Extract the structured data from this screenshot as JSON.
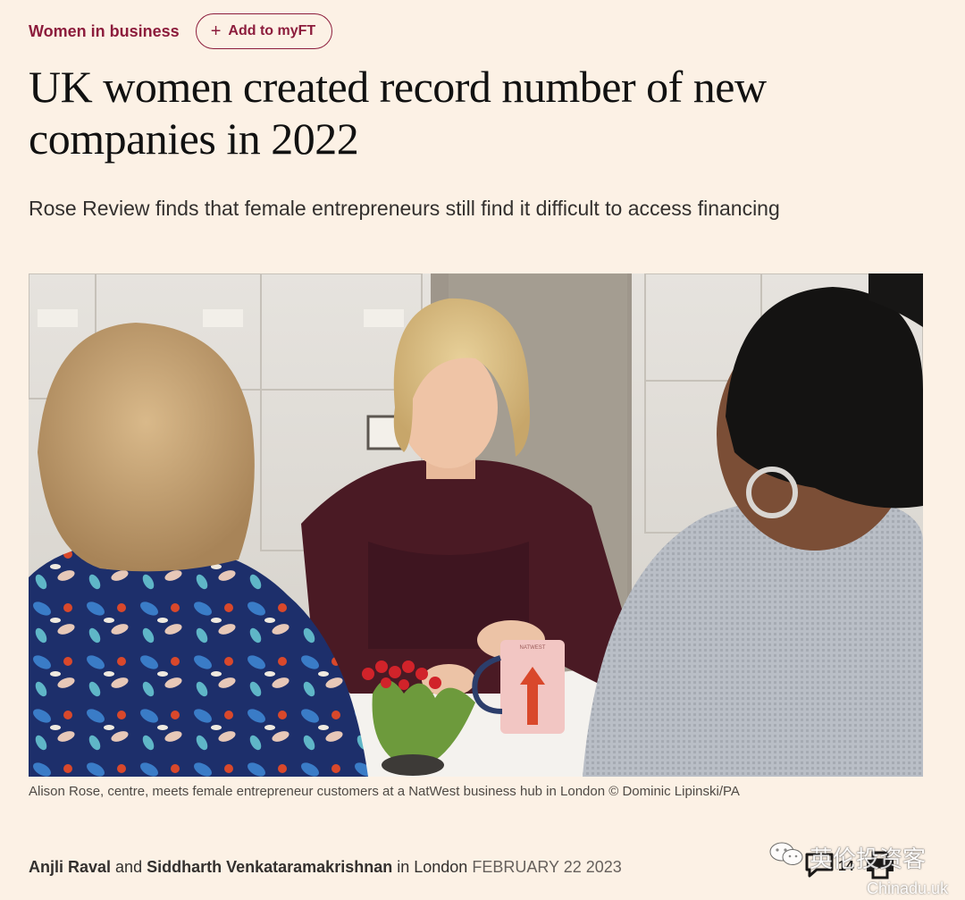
{
  "topic": {
    "label": "Women in business"
  },
  "myft_button": {
    "label": "Add to myFT",
    "icon": "plus-icon"
  },
  "headline": "UK women created record number of new companies in 2022",
  "standfirst": "Rose Review finds that female entrepreneurs still find it difficult to access financing",
  "image": {
    "mug_text": "NATWEST"
  },
  "caption": "Alison Rose, centre, meets female entrepreneur customers at a NatWest business hub in London © Dominic Lipinski/PA",
  "byline": {
    "author1": "Anjli Raval",
    "connector": "and",
    "author2": "Siddharth Venkataramakrishnan",
    "location": "in London",
    "date": "FEBRUARY 22 2023"
  },
  "tools": {
    "comments_count": "14",
    "comments_icon": "speech-bubble-icon",
    "print_icon": "printer-icon"
  },
  "watermark": {
    "line1": "英伦投资客",
    "line2": "Chinadu.uk",
    "icon": "wechat-icon"
  },
  "colors": {
    "background": "#fcf1e5",
    "accent": "#8c1c3c",
    "text": "#1a1817"
  }
}
